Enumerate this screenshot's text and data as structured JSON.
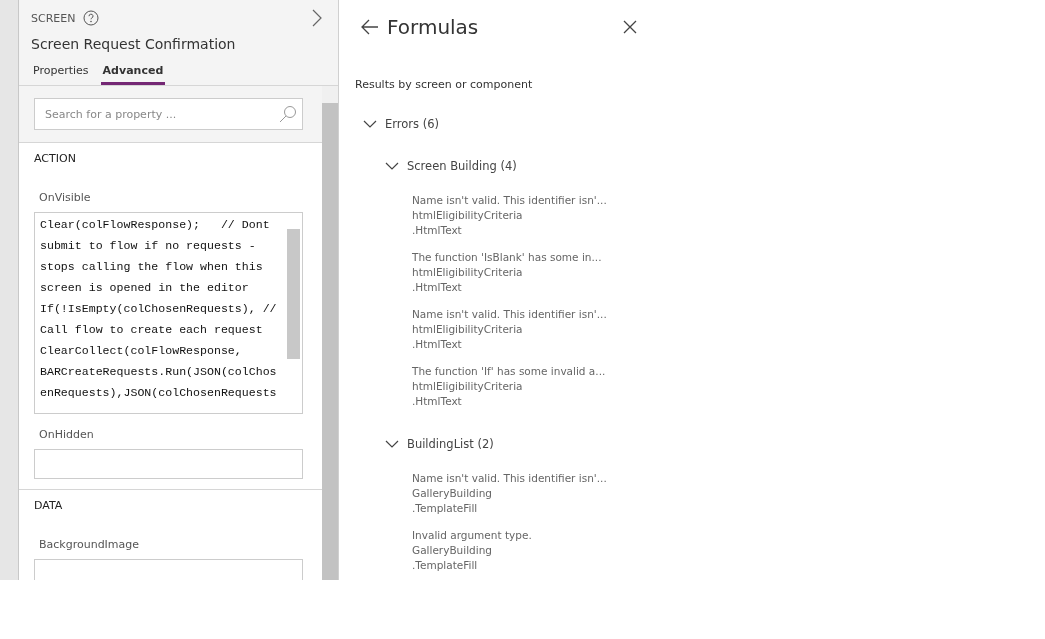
{
  "properties_panel": {
    "section_label": "SCREEN",
    "screen_name": "Screen Request Confirmation",
    "tabs": [
      {
        "label": "Properties",
        "selected": false
      },
      {
        "label": "Advanced",
        "selected": true
      }
    ],
    "search": {
      "placeholder": "Search for a property ..."
    },
    "sections": [
      {
        "title": "ACTION",
        "properties": [
          {
            "name": "OnVisible",
            "kind": "code",
            "lines": [
              "Clear(colFlowResponse);   // Dont",
              "submit to flow if no requests -",
              "stops calling the flow when this",
              "screen is opened in the editor",
              "If(!IsEmpty(colChosenRequests), //",
              "Call flow to create each request",
              "ClearCollect(colFlowResponse,",
              "BARCreateRequests.Run(JSON(colChos",
              "enRequests),JSON(colChosenRequests"
            ]
          },
          {
            "name": "OnHidden",
            "kind": "field"
          }
        ]
      },
      {
        "title": "DATA",
        "properties": [
          {
            "name": "BackgroundImage",
            "kind": "field"
          }
        ]
      }
    ]
  },
  "formulas_panel": {
    "title": "Formulas",
    "subtitle": "Results by screen or component",
    "tree": [
      {
        "label": "Errors (6)",
        "expanded": true,
        "children": [
          {
            "label": "Screen Building (4)",
            "expanded": true,
            "children": [
              {
                "message": "Name isn't valid. This identifier isn'...",
                "control": "htmlEligibilityCriteria",
                "property": ".HtmlText"
              },
              {
                "message": "The function 'IsBlank' has some in...",
                "control": "htmlEligibilityCriteria",
                "property": ".HtmlText"
              },
              {
                "message": "Name isn't valid. This identifier isn'...",
                "control": "htmlEligibilityCriteria",
                "property": ".HtmlText"
              },
              {
                "message": "The function 'If' has some invalid a...",
                "control": "htmlEligibilityCriteria",
                "property": ".HtmlText"
              }
            ]
          },
          {
            "label": "BuildingList (2)",
            "expanded": true,
            "children": [
              {
                "message": "Name isn't valid. This identifier isn'...",
                "control": "GalleryBuilding",
                "property": ".TemplateFill"
              },
              {
                "message": "Invalid argument type.",
                "control": "GalleryBuilding",
                "property": ".TemplateFill"
              }
            ]
          }
        ]
      }
    ]
  }
}
